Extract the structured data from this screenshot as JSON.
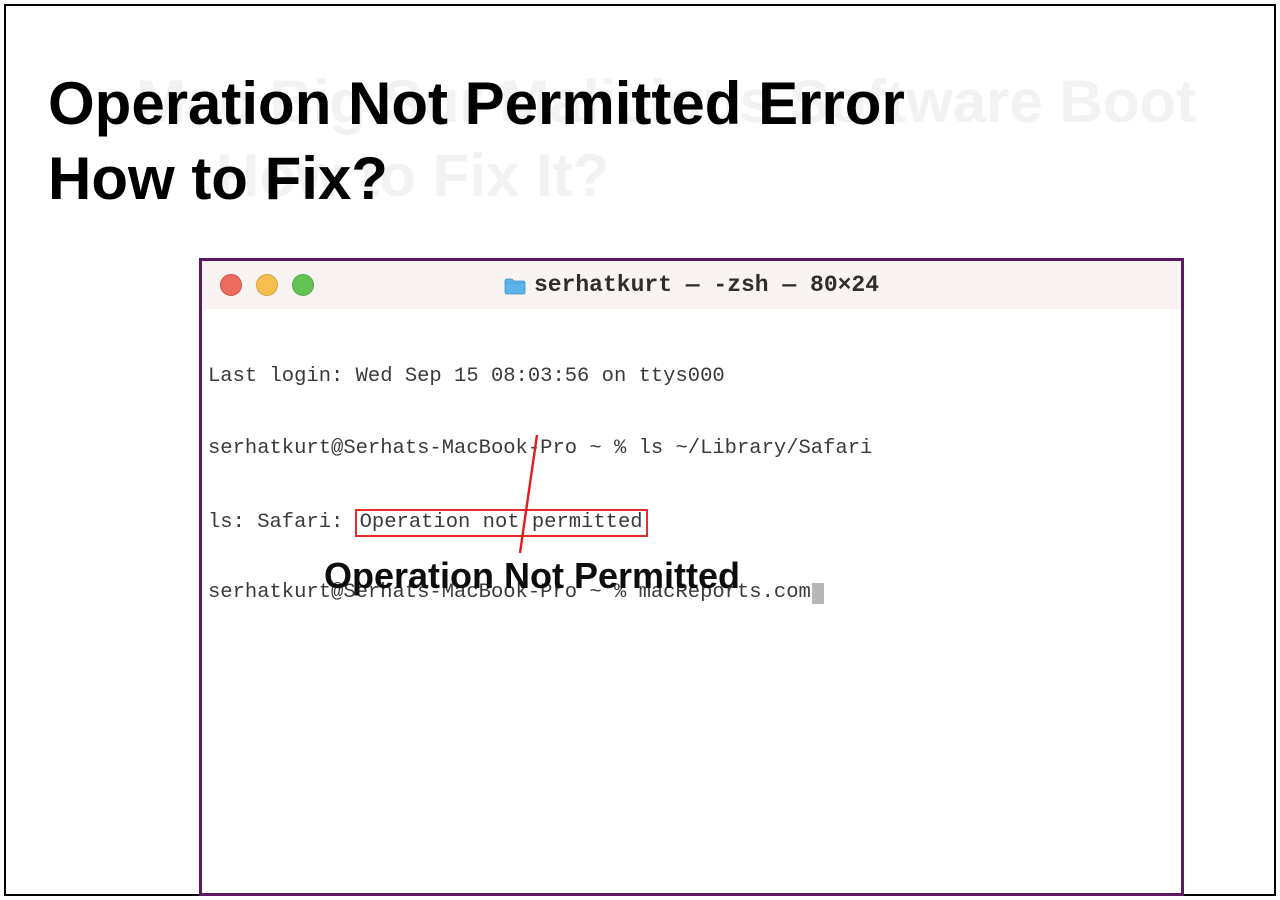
{
  "ghost": {
    "line1": "Mac Big Sur Malicious Software Boot",
    "line2": "How to Fix It?"
  },
  "heading": {
    "line1": "Operation Not Permitted Error",
    "line2": "How to Fix?"
  },
  "terminal": {
    "title": "serhatkurt — -zsh — 80×24",
    "lines": {
      "login": "Last login: Wed Sep 15 08:03:56 on ttys000",
      "prompt1": "serhatkurt@Serhats-MacBook-Pro ~ % ls ~/Library/Safari",
      "error_prefix": "ls: Safari: ",
      "error_text": "Operation not permitted",
      "prompt2_prefix": "serhatkurt@Serhats-MacBook-Pro ~ % ",
      "prompt2_text": "macReports.com"
    }
  },
  "callout": "Operation Not Permitted"
}
